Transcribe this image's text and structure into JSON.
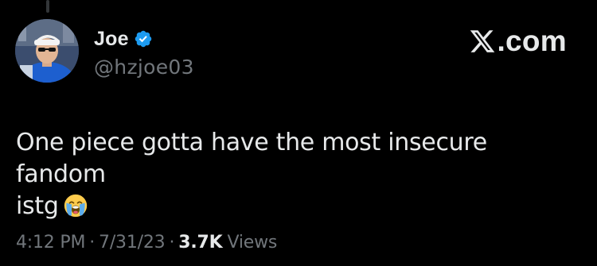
{
  "author": {
    "display_name": "Joe",
    "handle": "@hzjoe03",
    "verified": true
  },
  "brand": {
    "suffix": ".com",
    "icon": "x-logo-icon"
  },
  "tweet": {
    "text_line1": "One piece gotta have the most insecure fandom",
    "text_line2": "istg",
    "emoji": "loudly-crying-face-icon"
  },
  "meta": {
    "time": "4:12 PM",
    "separator": "·",
    "date": "7/31/23",
    "views_count": "3.7K",
    "views_label": "Views"
  },
  "colors": {
    "background": "#000000",
    "primary_text": "#e7e9ea",
    "secondary_text": "#71767b",
    "verified_blue": "#1d9bf0"
  }
}
